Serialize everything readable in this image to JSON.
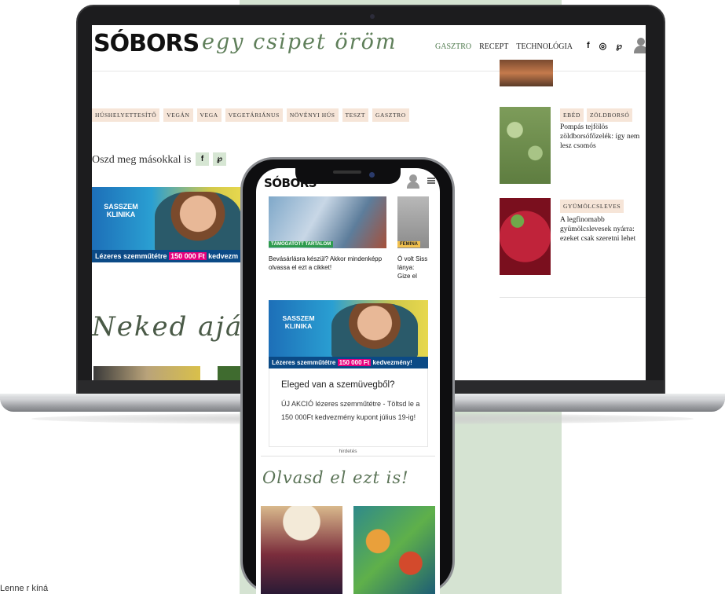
{
  "laptop": {
    "logo": "SÓBORS",
    "tagline": "egy csipet öröm",
    "nav": [
      "GASZTRO",
      "RECEPT",
      "TECHNOLÓGIA"
    ],
    "social_icons": [
      "facebook-icon",
      "instagram-icon",
      "pinterest-icon"
    ],
    "tags": [
      "HÚSHELYETTESÍTŐ",
      "VEGÁN",
      "VEGA",
      "VEGETÁRIÁNUS",
      "NÖVÉNYI HÚS",
      "TESZT",
      "GASZTRO"
    ],
    "share_label": "Oszd meg másokkal is",
    "ad": {
      "brand": "SASSZEM KLINIKA",
      "strip_prefix": "Lézeres szemműtétre",
      "strip_amount": "150 000 Ft",
      "strip_suffix": "kedvezm"
    },
    "recommended_heading": "Neked ajánlott",
    "sidebar": [
      {
        "tags": [
          "EBÉD",
          "ZÖLDBORSÓ"
        ],
        "title": "Pompás tejfölös zöldborsófőzelék: így nem lesz csomós"
      },
      {
        "tags": [
          "GYÜMÖLCSLEVES"
        ],
        "title": "A legfinomabb gyümölcslevesek nyárra: ezeket csak szeretni lehet"
      }
    ]
  },
  "phone": {
    "logo": "SÓBORS",
    "cards": [
      {
        "badge": "TÁMOGATOTT TARTALOM",
        "title": "Bevásárlásra készül? Akkor mindenképp olvassa el ezt a cikket!"
      },
      {
        "badge": "FEMINA",
        "title": "Ó volt Siss lánya: Gize el"
      }
    ],
    "ad": {
      "brand": "SASSZEM KLINIKA",
      "strip_prefix": "Lézeres szemműtétre",
      "strip_amount": "150 000 Ft",
      "strip_suffix": "kedvezmény!",
      "title": "Eleged van a szemüvegből?",
      "body": "ÚJ AKCIÓ lézeres szemműtétre - Töltsd le a 150 000Ft kedvezmény kupont július 19-ig!",
      "label": "hirdetés"
    },
    "read_heading": "Olvasd el ezt is!"
  },
  "footer_fragment": "Lenne r kíná"
}
